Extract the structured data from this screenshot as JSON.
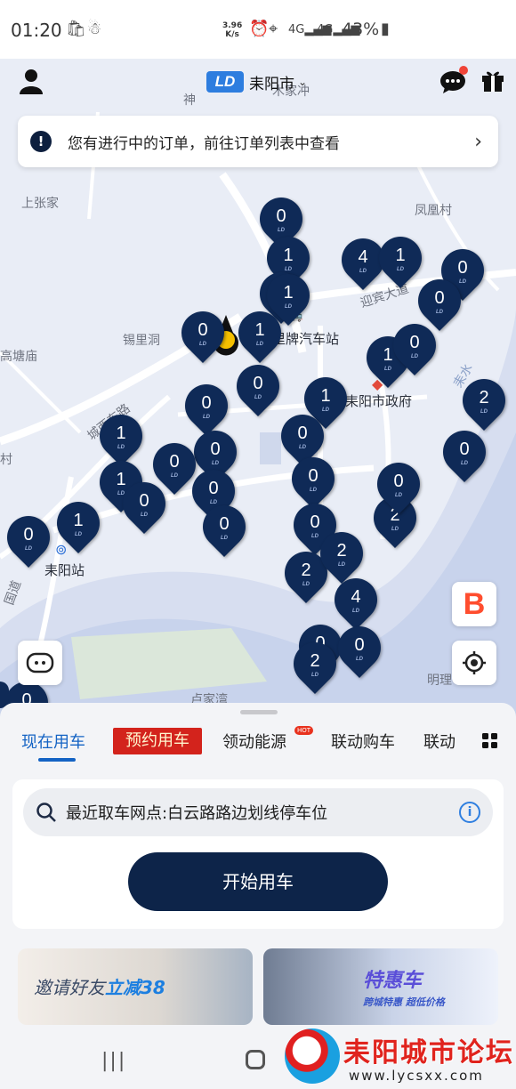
{
  "status_bar": {
    "time": "01:20",
    "net_speed_value": "3.96",
    "net_speed_unit": "K/s",
    "signal": "4G",
    "battery": "43%"
  },
  "header": {
    "logo_text": "LD",
    "city": "耒阳市"
  },
  "notice": {
    "text": "您有进行中的订单，前往订单列表中查看"
  },
  "map": {
    "labels": [
      "上张家",
      "凤凰村",
      "锡里洞",
      "高塘庙",
      "木家冲",
      "神",
      "村",
      "卢家湾",
      "明理"
    ],
    "poi": {
      "bus_station": "里牌汽车站",
      "gov": "耒阳市政府",
      "rail": "耒阳站",
      "road1": "迎宾大道",
      "road2": "城西东路",
      "road3": "国道",
      "river": "耒水"
    },
    "pins": [
      "0",
      "1",
      "0",
      "1",
      "4",
      "1",
      "0",
      "0",
      "0",
      "1",
      "1",
      "0",
      "0",
      "1",
      "2",
      "0",
      "0",
      "1",
      "0",
      "0",
      "0",
      "1",
      "0",
      "0",
      "0",
      "1",
      "0",
      "2",
      "0",
      "0",
      "0",
      "2",
      "2",
      "4",
      "0",
      "0",
      "2",
      "0",
      "0"
    ]
  },
  "panel": {
    "tabs": [
      "现在用车",
      "预约用车",
      "领动能源",
      "联动购车",
      "联动"
    ],
    "hot_badge": "HOT",
    "search_text": "最近取车网点:白云路路边划线停车位",
    "start_button": "开始用车",
    "banner1": {
      "prefix": "邀请好友",
      "highlight": "立减38"
    },
    "banner2": {
      "title": "特惠车",
      "subtitle": "跨城特惠  超低价格"
    }
  },
  "watermark": {
    "title": "耒阳城市论坛",
    "url": "www.lycsxx.com"
  }
}
